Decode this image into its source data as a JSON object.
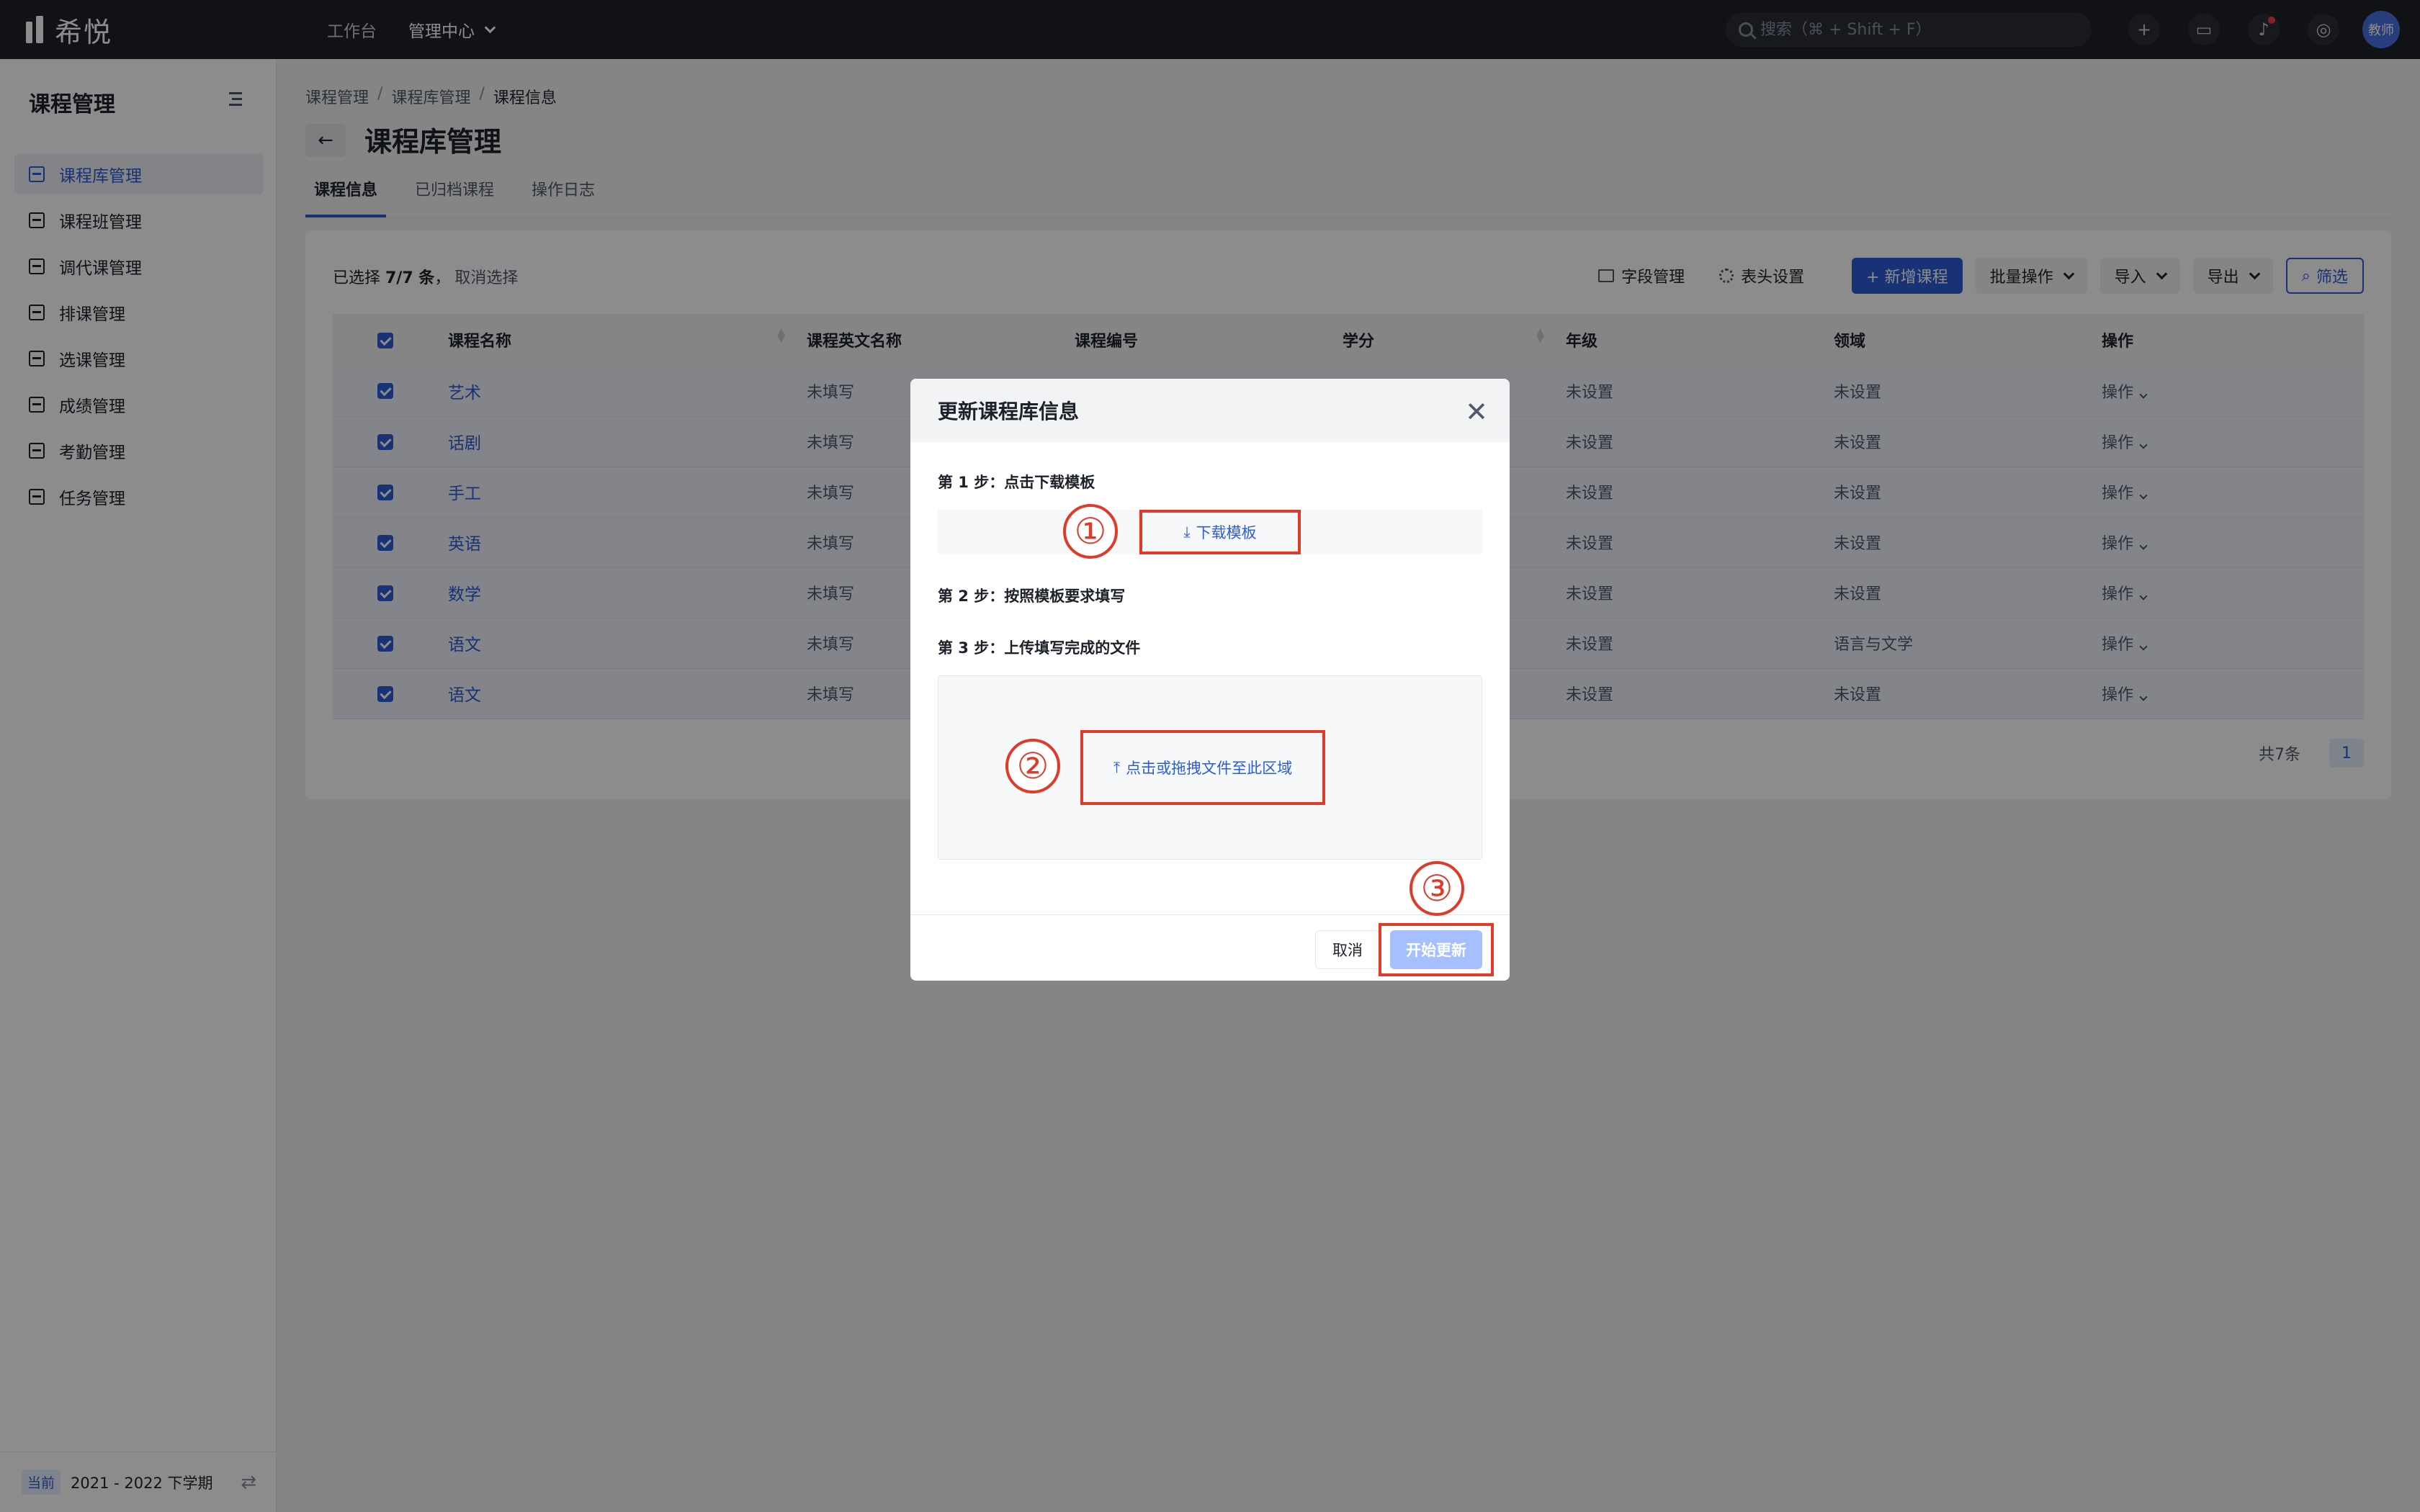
{
  "app": {
    "name": "希悦"
  },
  "topnav": {
    "workbench": "工作台",
    "admin_center": "管理中心"
  },
  "search": {
    "placeholder": "搜索（⌘ + Shift + F）"
  },
  "user": {
    "avatar_text": "教师"
  },
  "sidebar": {
    "title": "课程管理",
    "items": [
      {
        "label": "课程库管理",
        "active": true
      },
      {
        "label": "课程班管理"
      },
      {
        "label": "调代课管理"
      },
      {
        "label": "排课管理"
      },
      {
        "label": "选课管理"
      },
      {
        "label": "成绩管理"
      },
      {
        "label": "考勤管理"
      },
      {
        "label": "任务管理"
      }
    ],
    "term_badge": "当前",
    "term": "2021 - 2022 下学期"
  },
  "breadcrumb": [
    "课程管理",
    "课程库管理",
    "课程信息"
  ],
  "page_title": "课程库管理",
  "tabs": [
    "课程信息",
    "已归档课程",
    "操作日志"
  ],
  "selection": {
    "prefix": "已选择 ",
    "count": "7/7 条",
    "suffix": "，",
    "cancel": "取消选择"
  },
  "toolbar": {
    "field_manage": "字段管理",
    "header_settings": "表头设置",
    "add_course": "+ 新增课程",
    "batch": "批量操作",
    "import": "导入",
    "export": "导出",
    "filter": "筛选"
  },
  "table": {
    "columns": [
      "课程名称",
      "课程英文名称",
      "课程编号",
      "学分",
      "年级",
      "领域",
      "操作"
    ],
    "rows": [
      {
        "name": "艺术",
        "en": "未填写",
        "grade": "未设置",
        "domain": "未设置",
        "op": "操作"
      },
      {
        "name": "话剧",
        "en": "未填写",
        "grade": "未设置",
        "domain": "未设置",
        "op": "操作"
      },
      {
        "name": "手工",
        "en": "未填写",
        "grade": "未设置",
        "domain": "未设置",
        "op": "操作"
      },
      {
        "name": "英语",
        "en": "未填写",
        "grade": "未设置",
        "domain": "未设置",
        "op": "操作"
      },
      {
        "name": "数学",
        "en": "未填写",
        "grade": "未设置",
        "domain": "未设置",
        "op": "操作"
      },
      {
        "name": "语文",
        "en": "未填写",
        "grade": "未设置",
        "domain": "语言与文学",
        "op": "操作"
      },
      {
        "name": "语文",
        "en": "未填写",
        "grade": "未设置",
        "domain": "未设置",
        "op": "操作"
      }
    ]
  },
  "pagination": {
    "total": "共7条",
    "page": "1"
  },
  "modal": {
    "title": "更新课程库信息",
    "close": "✕",
    "step1": "第 1 步：点击下载模板",
    "download": "下载模板",
    "step2": "第 2 步：按照模板要求填写",
    "step3": "第 3 步：上传填写完成的文件",
    "upload": "点击或拖拽文件至此区域",
    "cancel": "取消",
    "start": "开始更新",
    "annotations": [
      "①",
      "②",
      "③"
    ]
  },
  "colors": {
    "brand": "#2d5cd8",
    "annotation": "#e03a2b",
    "topbar": "#1f2229"
  }
}
